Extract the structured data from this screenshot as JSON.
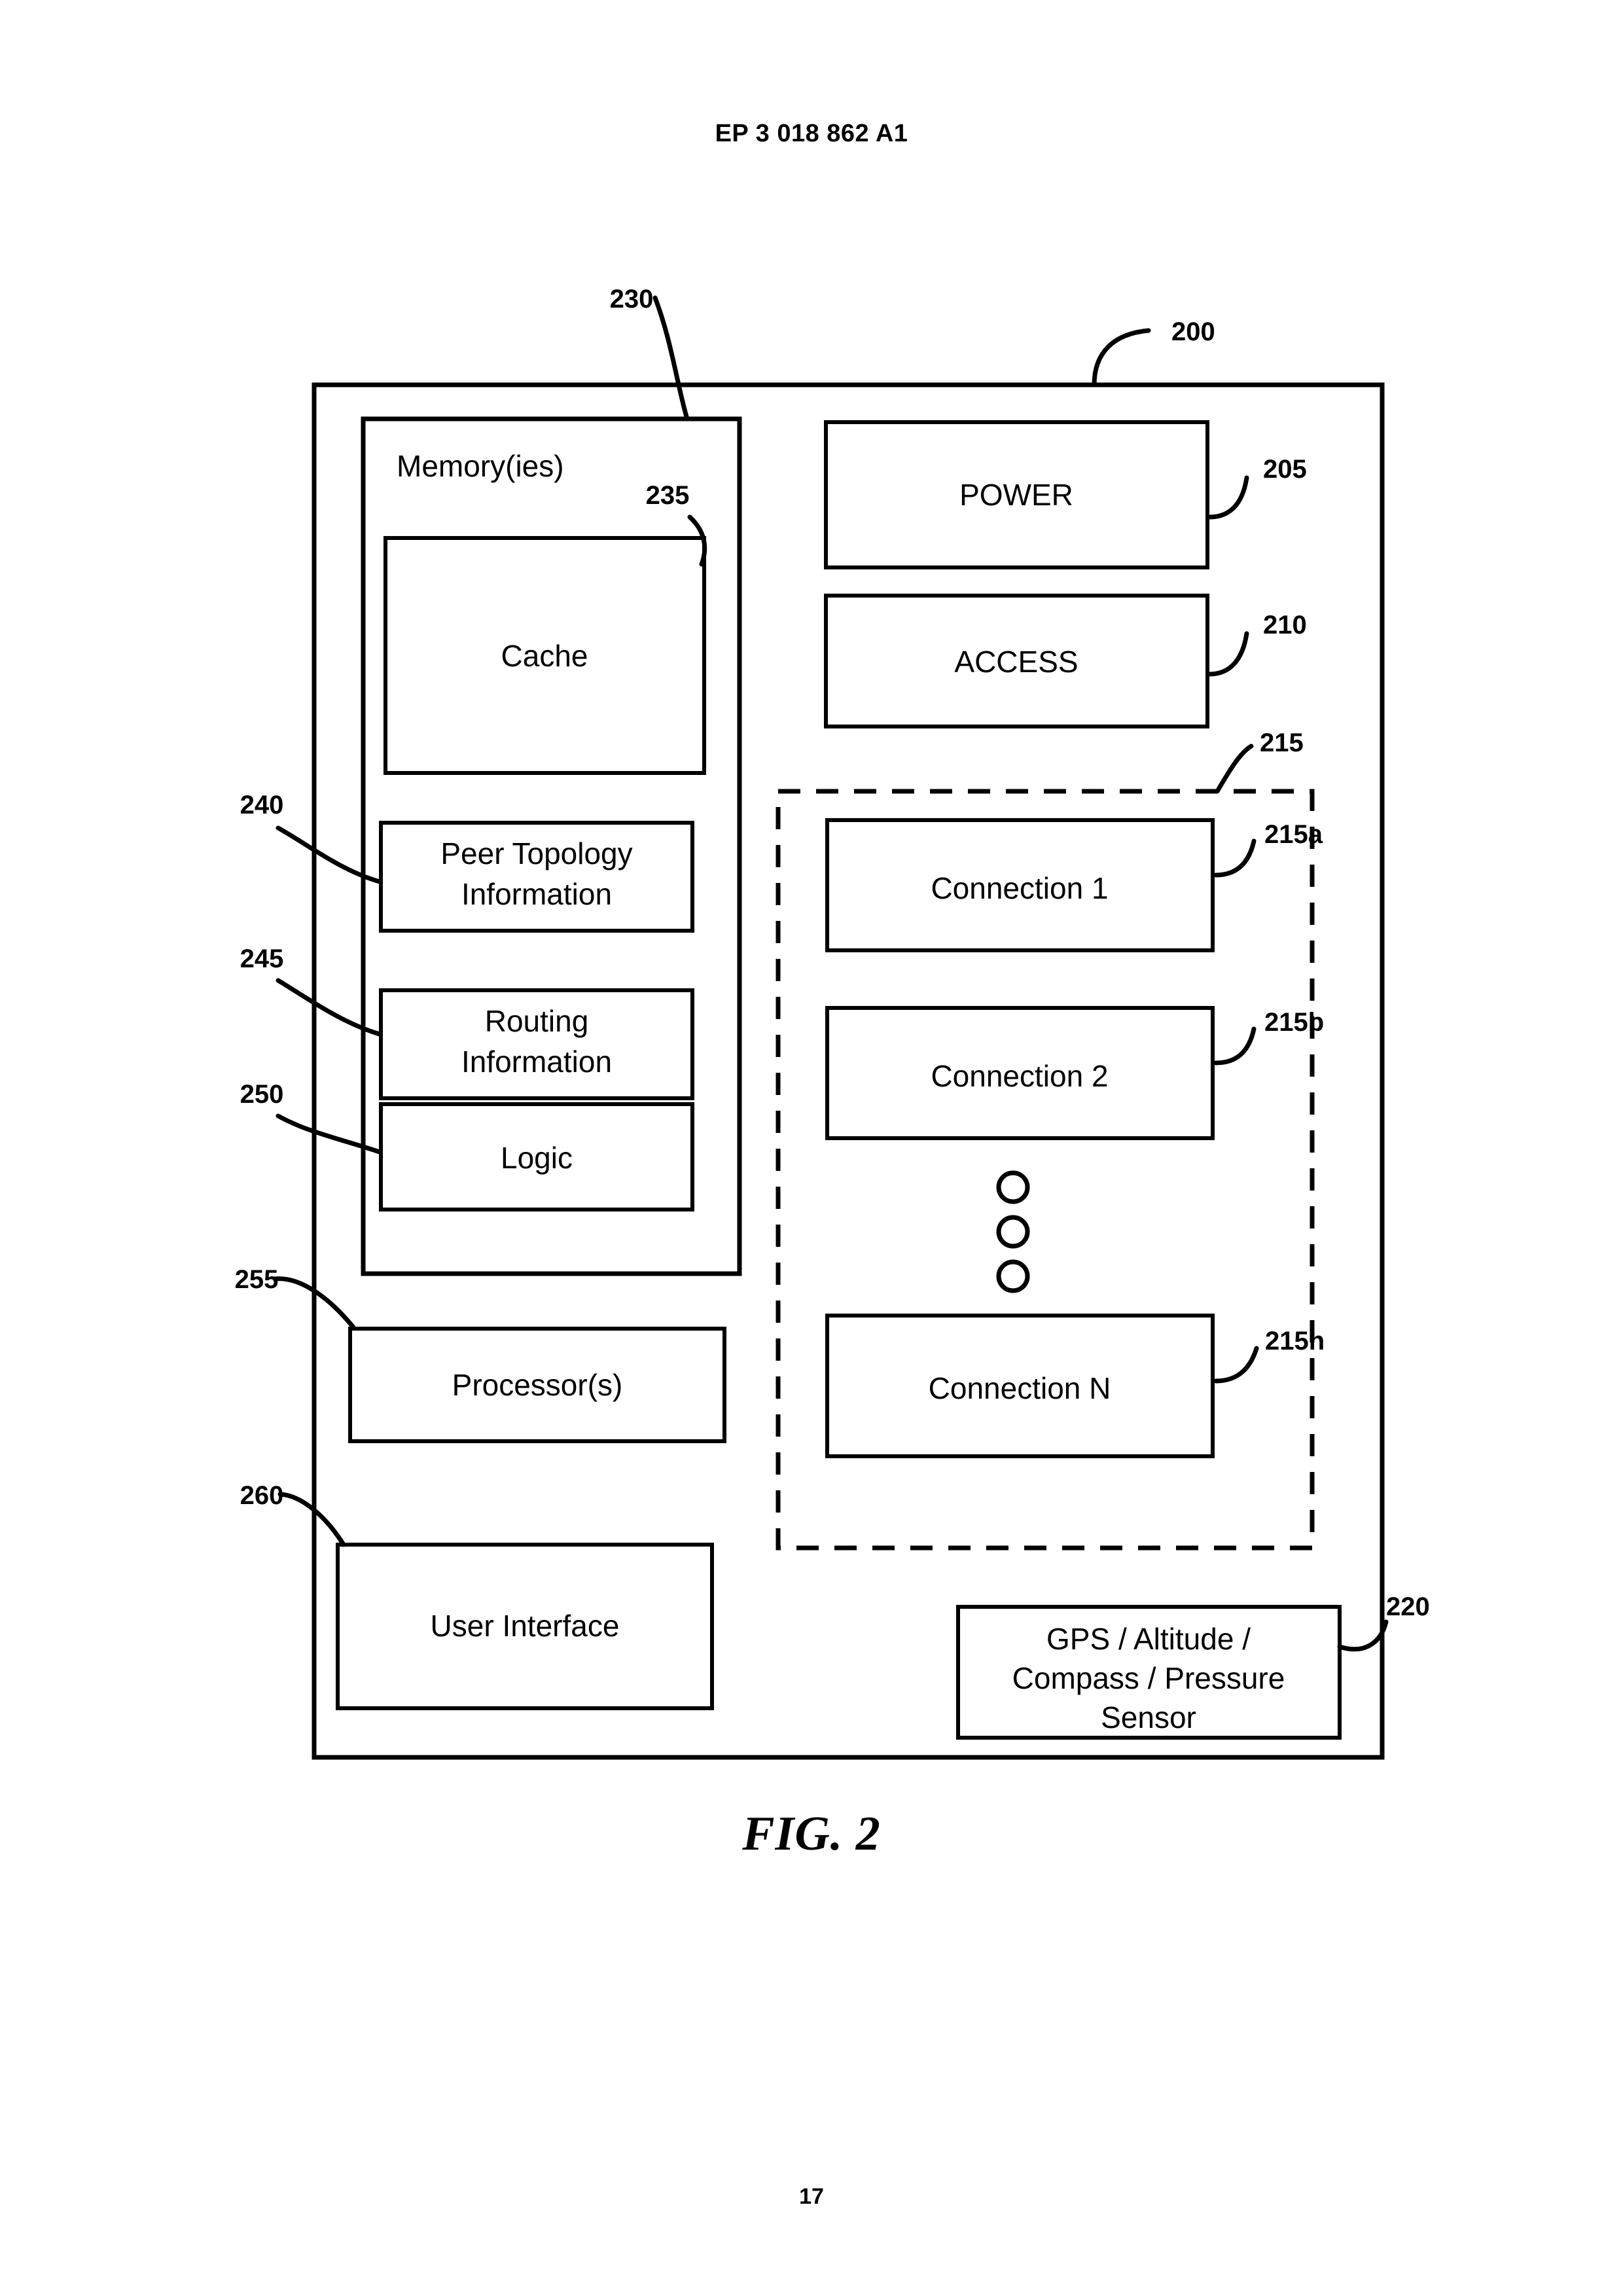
{
  "document": {
    "publication_header": "EP 3 018 862 A1",
    "page_number": "17",
    "figure_caption": "FIG. 2"
  },
  "figure": {
    "device": {
      "ref": "200",
      "name": "device-outer-box"
    },
    "memory": {
      "ref": "230",
      "title": "Memory(ies)",
      "blocks": [
        {
          "ref": "235",
          "label": "Cache"
        },
        {
          "ref": "240",
          "label_line1": "Peer Topology",
          "label_line2": "Information"
        },
        {
          "ref": "245",
          "label_line1": "Routing",
          "label_line2": "Information"
        },
        {
          "ref": "250",
          "label": "Logic"
        }
      ]
    },
    "processor": {
      "ref": "255",
      "label": "Processor(s)"
    },
    "user_interface": {
      "ref": "260",
      "label": "User Interface"
    },
    "power": {
      "ref": "205",
      "label": "POWER"
    },
    "access": {
      "ref": "210",
      "label": "ACCESS"
    },
    "connections_group": {
      "ref": "215",
      "items": [
        {
          "ref": "215a",
          "label": "Connection 1"
        },
        {
          "ref": "215b",
          "label": "Connection 2"
        },
        {
          "ref": "215n",
          "label": "Connection N"
        }
      ],
      "ellipsis": "vertical-three-circles"
    },
    "sensor": {
      "ref": "220",
      "label_line1": "GPS / Altitude /",
      "label_line2": "Compass / Pressure",
      "label_line3": "Sensor"
    }
  },
  "colors": {
    "ink": "#000000",
    "paper": "#ffffff"
  }
}
